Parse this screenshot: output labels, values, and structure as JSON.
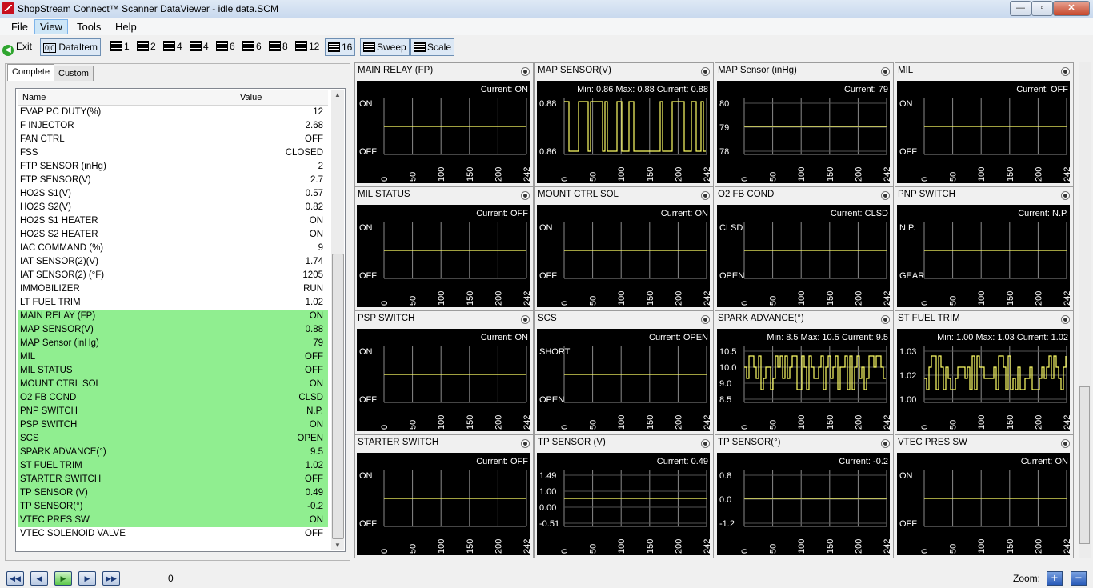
{
  "window": {
    "title": "ShopStream Connect™ Scanner DataViewer - idle data.SCM"
  },
  "menu": [
    "File",
    "View",
    "Tools",
    "Help"
  ],
  "toolbar": {
    "exit_label": "Exit",
    "dataitem_label": "DataItem",
    "layouts": [
      "1",
      "2",
      "4",
      "4",
      "6",
      "6",
      "8",
      "12",
      "16"
    ],
    "sweep_label": "Sweep",
    "scale_label": "Scale"
  },
  "tabs": [
    "Complete",
    "Custom"
  ],
  "list": {
    "col_name": "Name",
    "col_value": "Value",
    "rows": [
      {
        "name": "EVAP PC DUTY(%)",
        "value": "12",
        "sel": false
      },
      {
        "name": "F INJECTOR",
        "value": "2.68",
        "sel": false
      },
      {
        "name": "FAN CTRL",
        "value": "OFF",
        "sel": false
      },
      {
        "name": "FSS",
        "value": "CLOSED",
        "sel": false
      },
      {
        "name": "FTP SENSOR (inHg)",
        "value": "2",
        "sel": false
      },
      {
        "name": "FTP SENSOR(V)",
        "value": "2.7",
        "sel": false
      },
      {
        "name": "HO2S S1(V)",
        "value": "0.57",
        "sel": false
      },
      {
        "name": "HO2S S2(V)",
        "value": "0.82",
        "sel": false
      },
      {
        "name": "HO2S S1 HEATER",
        "value": "ON",
        "sel": false
      },
      {
        "name": "HO2S S2 HEATER",
        "value": "ON",
        "sel": false
      },
      {
        "name": "IAC COMMAND (%)",
        "value": "9",
        "sel": false
      },
      {
        "name": "IAT SENSOR(2)(V)",
        "value": "1.74",
        "sel": false
      },
      {
        "name": "IAT SENSOR(2) (°F)",
        "value": "1205",
        "sel": false
      },
      {
        "name": "IMMOBILIZER",
        "value": "RUN",
        "sel": false
      },
      {
        "name": "LT FUEL TRIM",
        "value": "1.02",
        "sel": false
      },
      {
        "name": "MAIN RELAY (FP)",
        "value": "ON",
        "sel": true
      },
      {
        "name": "MAP SENSOR(V)",
        "value": "0.88",
        "sel": true
      },
      {
        "name": "MAP Sensor (inHg)",
        "value": "79",
        "sel": true
      },
      {
        "name": "MIL",
        "value": "OFF",
        "sel": true
      },
      {
        "name": "MIL STATUS",
        "value": "OFF",
        "sel": true
      },
      {
        "name": "MOUNT CTRL SOL",
        "value": "ON",
        "sel": true
      },
      {
        "name": "O2 FB COND",
        "value": "CLSD",
        "sel": true
      },
      {
        "name": "PNP SWITCH",
        "value": "N.P.",
        "sel": true
      },
      {
        "name": "PSP SWITCH",
        "value": "ON",
        "sel": true
      },
      {
        "name": "SCS",
        "value": "OPEN",
        "sel": true
      },
      {
        "name": "SPARK ADVANCE(°)",
        "value": "9.5",
        "sel": true
      },
      {
        "name": "ST FUEL TRIM",
        "value": "1.02",
        "sel": true
      },
      {
        "name": "STARTER SWITCH",
        "value": "OFF",
        "sel": true
      },
      {
        "name": "TP SENSOR (V)",
        "value": "0.49",
        "sel": true
      },
      {
        "name": "TP SENSOR(°)",
        "value": "-0.2",
        "sel": true
      },
      {
        "name": "VTEC PRES SW",
        "value": "ON",
        "sel": true
      },
      {
        "name": "VTEC SOLENOID VALVE",
        "value": "OFF",
        "sel": false
      }
    ]
  },
  "xticks": [
    "0",
    "50",
    "100",
    "150",
    "200",
    "242"
  ],
  "graphs": [
    {
      "title": "MAIN RELAY (FP)",
      "stats": "Current: ON",
      "ylabels": [
        "ON",
        "OFF"
      ],
      "mode": "flat",
      "level": 0.5
    },
    {
      "title": "MAP SENSOR(V)",
      "stats": "Min: 0.86     Max: 0.88     Current: 0.88",
      "ylabels": [
        "0.88",
        "0.86"
      ],
      "mode": "binary",
      "seed": 3
    },
    {
      "title": "MAP Sensor (inHg)",
      "stats": "Current: 79",
      "ylabels": [
        "80",
        "79",
        "78"
      ],
      "mode": "flat",
      "level": 0.5
    },
    {
      "title": "MIL",
      "stats": "Current: OFF",
      "ylabels": [
        "ON",
        "OFF"
      ],
      "mode": "flat",
      "level": 0.5
    },
    {
      "title": "MIL STATUS",
      "stats": "Current: OFF",
      "ylabels": [
        "ON",
        "OFF"
      ],
      "mode": "flat",
      "level": 0.5
    },
    {
      "title": "MOUNT CTRL SOL",
      "stats": "Current: ON",
      "ylabels": [
        "ON",
        "OFF"
      ],
      "mode": "flat",
      "level": 0.5
    },
    {
      "title": "O2 FB COND",
      "stats": "Current: CLSD",
      "ylabels": [
        "CLSD",
        "OPEN"
      ],
      "mode": "flat",
      "level": 0.5
    },
    {
      "title": "PNP SWITCH",
      "stats": "Current: N.P.",
      "ylabels": [
        "N.P.",
        "GEAR"
      ],
      "mode": "flat",
      "level": 0.5
    },
    {
      "title": "PSP SWITCH",
      "stats": "Current: ON",
      "ylabels": [
        "ON",
        "OFF"
      ],
      "mode": "flat",
      "level": 0.5
    },
    {
      "title": "SCS",
      "stats": "Current: OPEN",
      "ylabels": [
        "SHORT",
        "OPEN"
      ],
      "mode": "flat",
      "level": 0.5
    },
    {
      "title": "SPARK ADVANCE(°)",
      "stats": "Min: 8.5     Max: 10.5     Current: 9.5",
      "ylabels": [
        "10.5",
        "10.0",
        "9.0",
        "8.5"
      ],
      "mode": "noise",
      "seed": 7
    },
    {
      "title": "ST FUEL TRIM",
      "stats": "Min: 1.00     Max: 1.03     Current: 1.02",
      "ylabels": [
        "1.03",
        "1.02",
        "1.00"
      ],
      "mode": "noise",
      "seed": 11
    },
    {
      "title": "STARTER SWITCH",
      "stats": "Current: OFF",
      "ylabels": [
        "ON",
        "OFF"
      ],
      "mode": "flat",
      "level": 0.5
    },
    {
      "title": "TP SENSOR (V)",
      "stats": "Current: 0.49",
      "ylabels": [
        "1.49",
        "1.00",
        "0.00",
        "-0.51"
      ],
      "mode": "flat",
      "level": 0.5
    },
    {
      "title": "TP SENSOR(°)",
      "stats": "Current: -0.2",
      "ylabels": [
        "0.8",
        "0.0",
        "-1.2"
      ],
      "mode": "flat",
      "level": 0.5
    },
    {
      "title": "VTEC PRES SW",
      "stats": "Current: ON",
      "ylabels": [
        "ON",
        "OFF"
      ],
      "mode": "flat",
      "level": 0.5
    }
  ],
  "bottom": {
    "position": "0",
    "zoom_label": "Zoom:"
  },
  "colors": {
    "trace": "#ffff66",
    "grid": "#8a8a8a",
    "plot_bg": "#000000",
    "selected_row": "#90ee90"
  }
}
